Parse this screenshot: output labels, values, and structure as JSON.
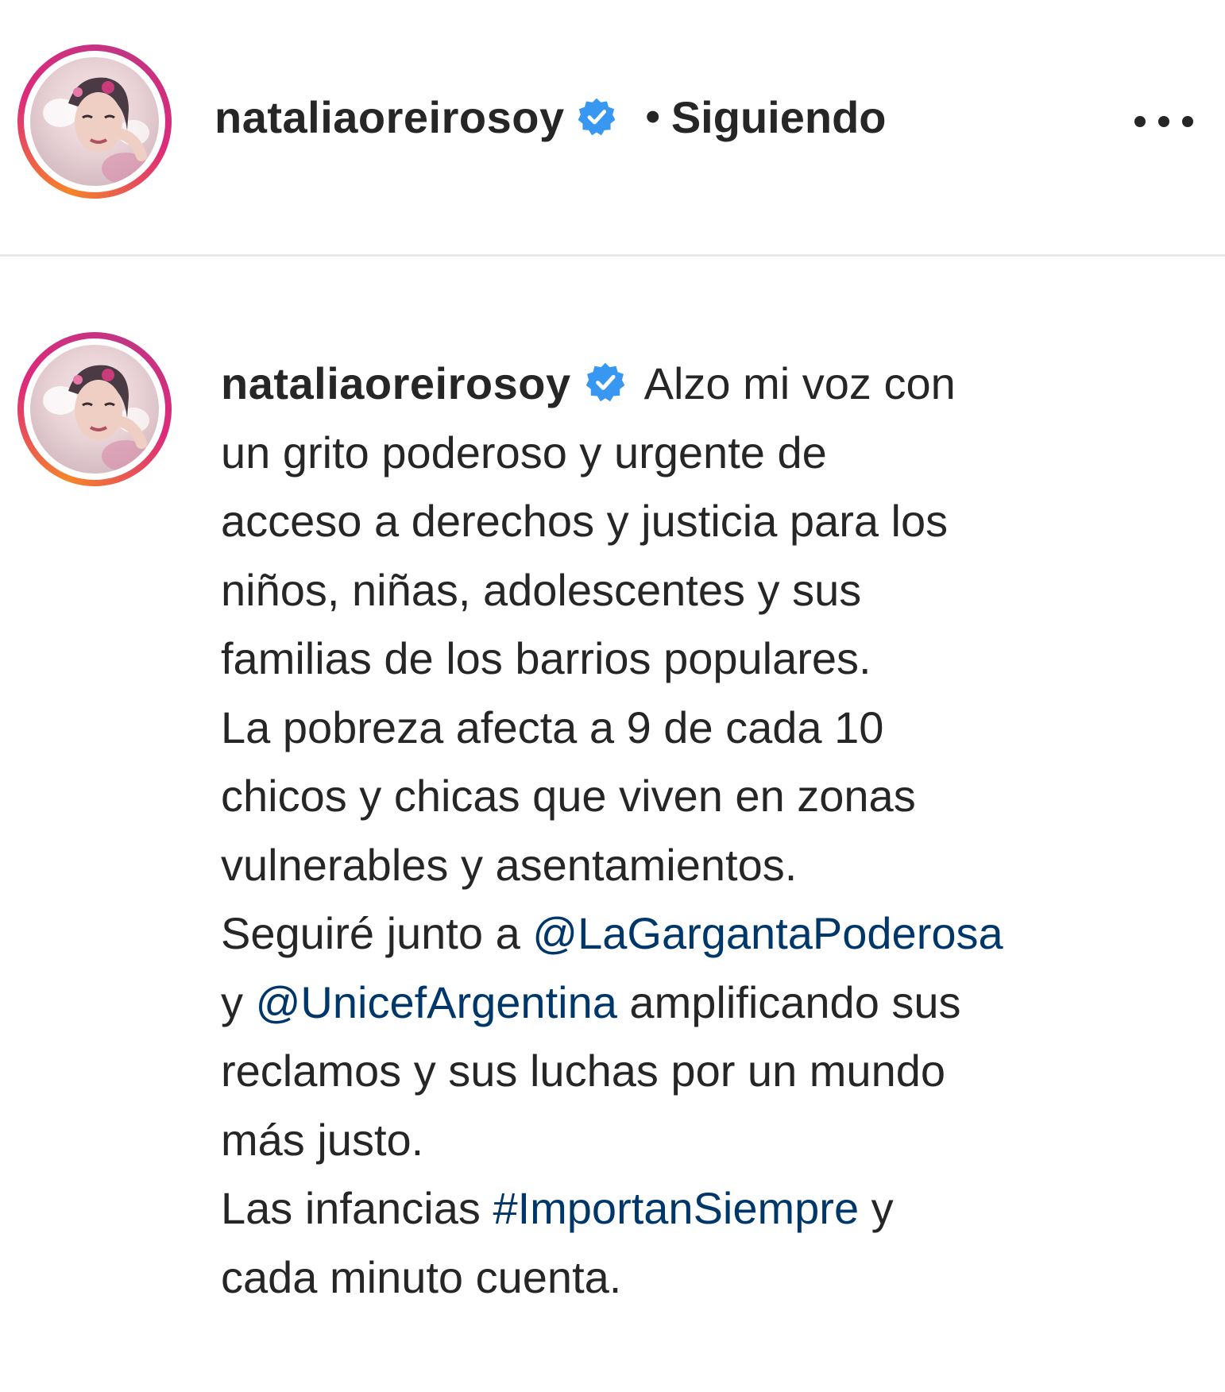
{
  "header": {
    "username": "nataliaoreirosoy",
    "separator": "•",
    "follow_status": "Siguiendo",
    "more_icon": "more-horizontal-icon",
    "verified_icon": "verified-badge-icon",
    "verified_color": "#3897f0"
  },
  "comment": {
    "username": "nataliaoreirosoy",
    "lines": [
      "Alzo mi voz con",
      "un grito poderoso y urgente de",
      "acceso a derechos y justicia para los",
      "niños, niñas, adolescentes y sus",
      "familias de los barrios populares.",
      "La pobreza afecta a 9 de cada 10",
      "chicos y chicas que viven en zonas",
      "vulnerables y asentamientos.",
      "Seguiré junto a ",
      "@LaGargantaPoderosa",
      "y ",
      "@UnicefArgentina",
      " amplificando sus",
      "reclamos y sus luchas por un mundo",
      "más justo.",
      "Las infancias ",
      "#ImportanSiempre",
      " y",
      "cada minuto cuenta."
    ],
    "link_color": "#00376b"
  },
  "colors": {
    "text": "#262626",
    "divider": "#e8e8e8",
    "avatar_ring_start": "#f58529",
    "avatar_ring_end": "#dd2a7b"
  }
}
